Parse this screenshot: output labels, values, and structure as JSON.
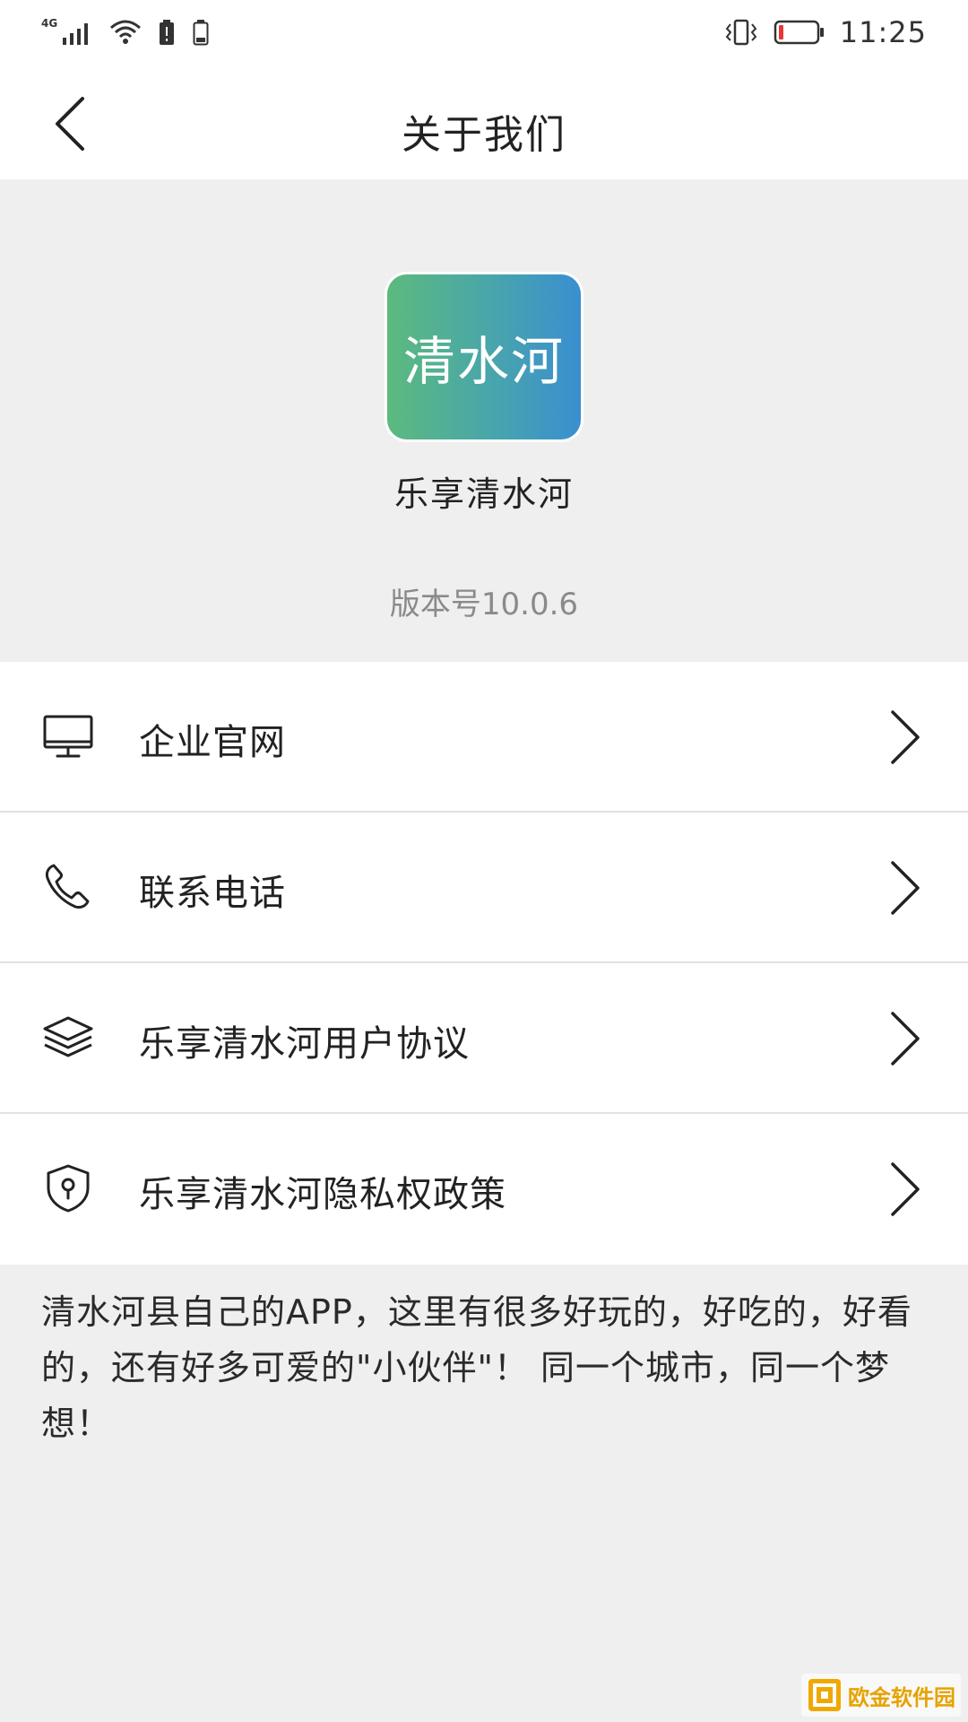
{
  "status_bar": {
    "network_label": "4G",
    "time": "11:25",
    "icons": [
      "signal-icon",
      "wifi-icon",
      "alert-battery-icon",
      "battery-outline-icon",
      "vibrate-icon",
      "battery-low-icon"
    ]
  },
  "nav": {
    "title": "关于我们",
    "back_icon": "chevron-left-icon"
  },
  "app": {
    "logo_text": "清水河",
    "name": "乐享清水河",
    "version": "版本号10.0.6",
    "logo_gradient": [
      "#5cba7e",
      "#3a8fd0"
    ]
  },
  "menu": {
    "items": [
      {
        "label": "企业官网",
        "icon": "monitor-icon"
      },
      {
        "label": "联系电话",
        "icon": "phone-icon"
      },
      {
        "label": "乐享清水河用户协议",
        "icon": "layers-icon"
      },
      {
        "label": "乐享清水河隐私权政策",
        "icon": "shield-icon"
      }
    ]
  },
  "description": "清水河县自己的APP，这里有很多好玩的，好吃的，好看的，还有好多可爱的\"小伙伴\"！ 同一个城市，同一个梦想！",
  "watermark": {
    "text": "欧金软件园"
  },
  "colors": {
    "background": "#efefef",
    "card": "#ffffff",
    "text": "#222222",
    "muted": "#8a8a8a",
    "battery_low": "#e53935"
  }
}
